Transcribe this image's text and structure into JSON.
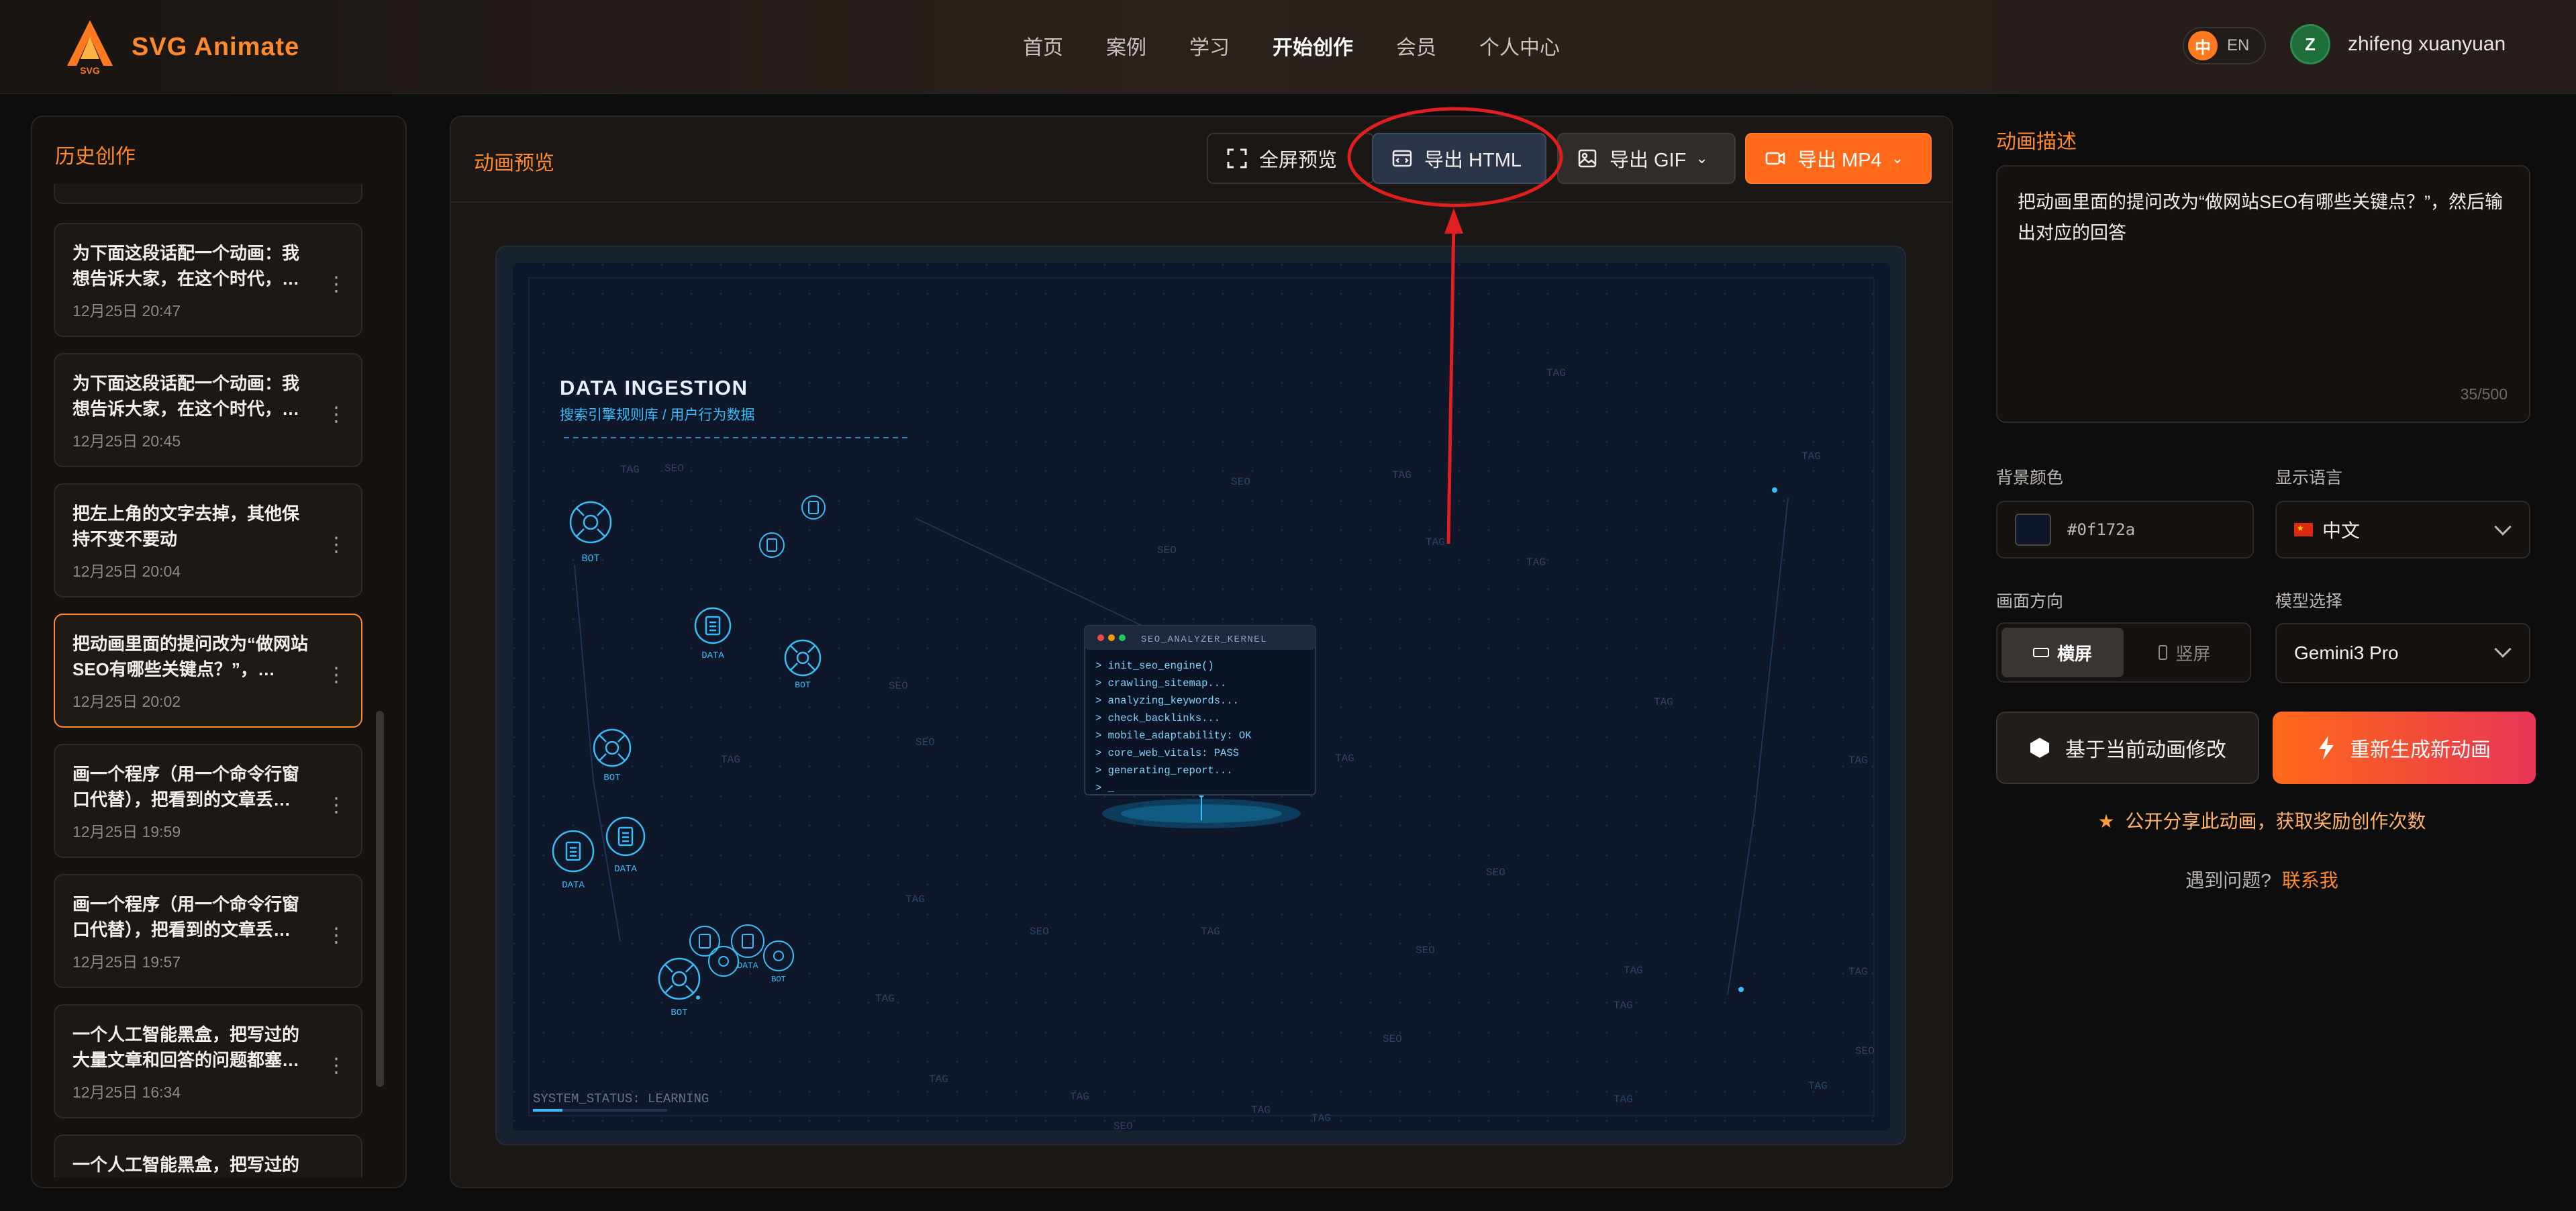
{
  "app": {
    "logo_text": "SVG Animate",
    "logo_sub": "SVG"
  },
  "nav": {
    "items": [
      "首页",
      "案例",
      "学习",
      "开始创作",
      "会员",
      "个人中心"
    ],
    "active": "开始创作"
  },
  "lang": {
    "zh": "中",
    "en": "EN"
  },
  "user": {
    "initial": "Z",
    "name": "zhifeng xuanyuan"
  },
  "history": {
    "title": "历史创作",
    "items": [
      {
        "text": "为下面这段话配一个动画：我想告诉大家，在这个时代，…",
        "time": "12月25日 20:47"
      },
      {
        "text": "为下面这段话配一个动画：我想告诉大家，在这个时代，…",
        "time": "12月25日 20:45"
      },
      {
        "text": "把左上角的文字去掉，其他保持不变不要动",
        "time": "12月25日 20:04"
      },
      {
        "text": "把动画里面的提问改为“做网站SEO有哪些关键点？”，…",
        "time": "12月25日 20:02"
      },
      {
        "text": "画一个程序（用一个命令行窗口代替），把看到的文章丢…",
        "time": "12月25日 19:59"
      },
      {
        "text": "画一个程序（用一个命令行窗口代替），把看到的文章丢…",
        "time": "12月25日 19:57"
      },
      {
        "text": "一个人工智能黑盒，把写过的大量文章和回答的问题都塞…",
        "time": "12月25日 16:34"
      },
      {
        "text": "一个人工智能黑盒，把写过的",
        "time": ""
      }
    ]
  },
  "preview": {
    "title": "动画预览",
    "fullscreen_label": "全屏预览",
    "export_html_label": "导出 HTML",
    "export_gif_label": "导出 GIF",
    "export_mp4_label": "导出 MP4"
  },
  "animation": {
    "heading": "DATA INGESTION",
    "subheading": "搜索引擎规则库 / 用户行为数据",
    "terminal_title": "SEO_ANALYZER_KERNEL",
    "terminal_lines": [
      "> init_seo_engine()",
      "> crawling_sitemap...",
      "> analyzing_keywords...",
      "> check_backlinks...",
      "> mobile_adaptability: OK",
      "> core_web_vitals: PASS",
      "> generating_report...",
      "> _"
    ],
    "status": "SYSTEM_STATUS: LEARNING",
    "bot_label": "BOT",
    "data_label": "DATA",
    "tag_label": "TAG",
    "seo_label": "SEO"
  },
  "settings": {
    "desc_label": "动画描述",
    "desc_text": "把动画里面的提问改为“做网站SEO有哪些关键点？”，然后输出对应的回答",
    "desc_count": "35/500",
    "bg_label": "背景颜色",
    "bg_value": "#0f172a",
    "lang_label": "显示语言",
    "lang_value": "中文",
    "orient_label": "画面方向",
    "orient_landscape": "横屏",
    "orient_portrait": "竖屏",
    "model_label": "模型选择",
    "model_value": "Gemini3 Pro",
    "modify_label": "基于当前动画修改",
    "regen_label": "重新生成新动画",
    "share_text": "公开分享此动画，获取奖励创作次数",
    "help_text": "遇到问题?",
    "help_link": "联系我"
  },
  "colors": {
    "accent": "#ff8a2b",
    "mp4": "#ff6a1a",
    "stage_bg": "#0f172a",
    "cyan": "#38bdf8",
    "annotation": "#e02020"
  }
}
